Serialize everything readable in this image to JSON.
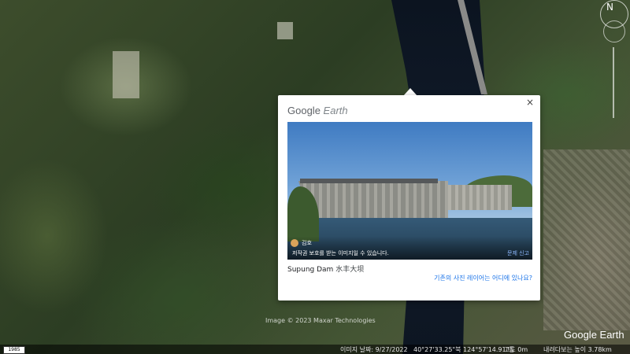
{
  "popup": {
    "brand_google": "Google",
    "brand_earth": "Earth",
    "close": "×",
    "photo": {
      "uploader": "김호",
      "copyright_note": "저작권 보호를 받는 이미지일 수 있습니다.",
      "report_link": "문제 신고"
    },
    "caption_en": "Supung Dam",
    "caption_local": "水丰大坝",
    "question_link": "기존의 사진 레이어는 어디에 있나요?"
  },
  "map": {
    "credit": "Image © 2023 Maxar Technologies",
    "logo": "Google Earth",
    "compass_n": "N"
  },
  "status": {
    "scale_badge": "1985",
    "imagery_date": "이미지 날짜: 9/27/2022",
    "coordinates": "40°27'33.25\"북  124°57'14.91\"동",
    "altitude": "고도    0m",
    "eye_alt": "내려다보는 높이  3.78km"
  }
}
